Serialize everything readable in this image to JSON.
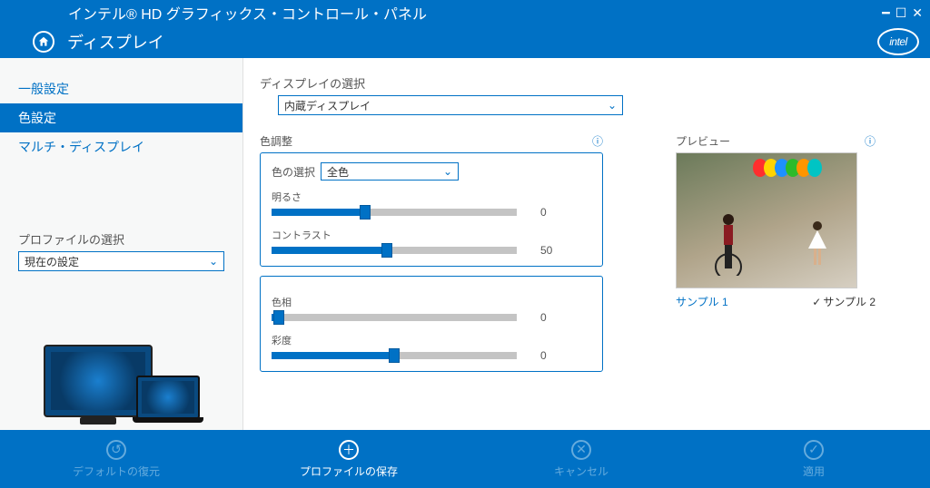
{
  "window": {
    "title": "インテル® HD グラフィックス・コントロール・パネル",
    "section": "ディスプレイ",
    "logo_text": "intel"
  },
  "sidebar": {
    "nav": [
      {
        "label": "一般設定",
        "active": false
      },
      {
        "label": "色設定",
        "active": true
      },
      {
        "label": "マルチ・ディスプレイ",
        "active": false
      }
    ],
    "profile_label": "プロファイルの選択",
    "profile_value": "現在の設定"
  },
  "main": {
    "display_select_label": "ディスプレイの選択",
    "display_select_value": "内蔵ディスプレイ",
    "adjust_label": "色調整",
    "color_select_label": "色の選択",
    "color_select_value": "全色",
    "sliders1": [
      {
        "label": "明るさ",
        "value": 0,
        "fillPct": 38,
        "thumbPct": 38
      },
      {
        "label": "コントラスト",
        "value": 50,
        "fillPct": 47,
        "thumbPct": 47
      }
    ],
    "sliders2": [
      {
        "label": "色相",
        "value": 0,
        "fillPct": 3,
        "thumbPct": 3
      },
      {
        "label": "彩度",
        "value": 0,
        "fillPct": 50,
        "thumbPct": 50
      }
    ],
    "preview_label": "プレビュー",
    "sample1": "サンプル 1",
    "sample2": "サンプル 2"
  },
  "footer": {
    "restore": "デフォルトの復元",
    "save": "プロファイルの保存",
    "cancel": "キャンセル",
    "apply": "適用"
  },
  "colors": {
    "balloons": [
      "#ff2e2e",
      "#ffd400",
      "#1e90ff",
      "#2bbb2b",
      "#ff9500",
      "#00c4c4"
    ]
  }
}
